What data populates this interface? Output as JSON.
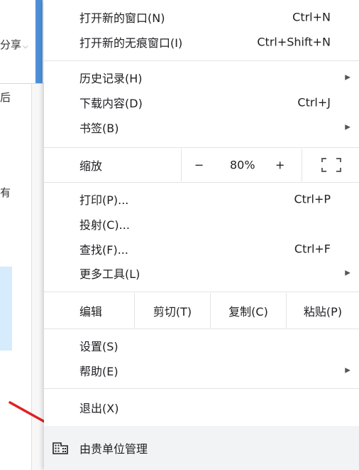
{
  "background": {
    "share_label": "分享",
    "share_caret": "⌵",
    "fragment_1": "后",
    "fragment_2": "有"
  },
  "menu": {
    "new_window": {
      "label": "打开新的窗口(N)",
      "shortcut": "Ctrl+N"
    },
    "new_incognito": {
      "label": "打开新的无痕窗口(I)",
      "shortcut": "Ctrl+Shift+N"
    },
    "history": {
      "label": "历史记录(H)",
      "arrow": "▶"
    },
    "downloads": {
      "label": "下载内容(D)",
      "shortcut": "Ctrl+J"
    },
    "bookmarks": {
      "label": "书签(B)",
      "arrow": "▶"
    },
    "zoom": {
      "label": "缩放",
      "minus": "−",
      "value": "80%",
      "plus": "+"
    },
    "print": {
      "label": "打印(P)...",
      "shortcut": "Ctrl+P"
    },
    "cast": {
      "label": "投射(C)..."
    },
    "find": {
      "label": "查找(F)...",
      "shortcut": "Ctrl+F"
    },
    "more_tools": {
      "label": "更多工具(L)",
      "arrow": "▶"
    },
    "edit": {
      "label": "编辑",
      "cut": "剪切(T)",
      "copy": "复制(C)",
      "paste": "粘贴(P)"
    },
    "settings": {
      "label": "设置(S)"
    },
    "help": {
      "label": "帮助(E)",
      "arrow": "▶"
    },
    "exit": {
      "label": "退出(X)"
    },
    "managed": {
      "label": "由贵单位管理"
    }
  },
  "colors": {
    "accent_blue": "#4f8fd6",
    "arrow_red": "#e02020",
    "managed_bg": "#f1f3f4"
  }
}
